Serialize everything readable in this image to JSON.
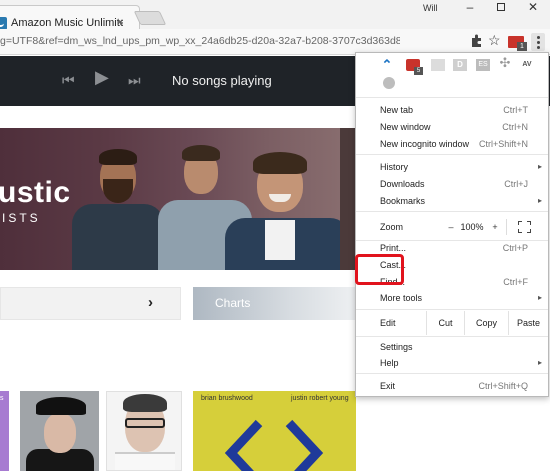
{
  "browser": {
    "tab_title": "Amazon Music Unlimited",
    "tab_close": "×",
    "profile_label": "Will",
    "window_minimize": "–",
    "window_close": "✕",
    "url_text": "g=UTF8&ref=dm_ws_lnd_ups_pm_wp_xx_24a6db25-d20a-32a7-b208-3707c3d363d8",
    "star": "☆",
    "ext_badge": "1"
  },
  "player": {
    "prev": "⏮",
    "play": "▶",
    "next": "⏭",
    "status": "No songs playing"
  },
  "hero": {
    "title": "ustic",
    "subtitle": "ISTS"
  },
  "nav": {
    "chevron": "›",
    "charts": "Charts"
  },
  "albums": {
    "album1_text": "s",
    "album4_artist_left": "brian brushwood",
    "album4_artist_right": "justin robert young"
  },
  "menu": {
    "extensions": {
      "anchor": "⌃",
      "lp_badge": "5",
      "d": "D",
      "es": "ES",
      "arrows": "✣",
      "av": "AV"
    },
    "items": [
      {
        "label": "New tab",
        "shortcut": "Ctrl+T"
      },
      {
        "label": "New window",
        "shortcut": "Ctrl+N"
      },
      {
        "label": "New incognito window",
        "shortcut": "Ctrl+Shift+N"
      },
      {
        "label": "History",
        "shortcut": "",
        "arrow": "▸"
      },
      {
        "label": "Downloads",
        "shortcut": "Ctrl+J"
      },
      {
        "label": "Bookmarks",
        "shortcut": "",
        "arrow": "▸"
      },
      {
        "label": "Print...",
        "shortcut": "Ctrl+P"
      },
      {
        "label": "Cast...",
        "shortcut": ""
      },
      {
        "label": "Find...",
        "shortcut": "Ctrl+F"
      },
      {
        "label": "More tools",
        "shortcut": "",
        "arrow": "▸"
      },
      {
        "label": "Settings",
        "shortcut": ""
      },
      {
        "label": "Help",
        "shortcut": "",
        "arrow": "▸"
      },
      {
        "label": "Exit",
        "shortcut": "Ctrl+Shift+Q"
      }
    ],
    "zoom": {
      "label": "Zoom",
      "minus": "–",
      "value": "100%",
      "plus": "+"
    },
    "edit": {
      "label": "Edit",
      "cut": "Cut",
      "copy": "Copy",
      "paste": "Paste"
    }
  },
  "colors": {
    "highlight": "#e1131d",
    "player_bg": "#1f2328"
  }
}
